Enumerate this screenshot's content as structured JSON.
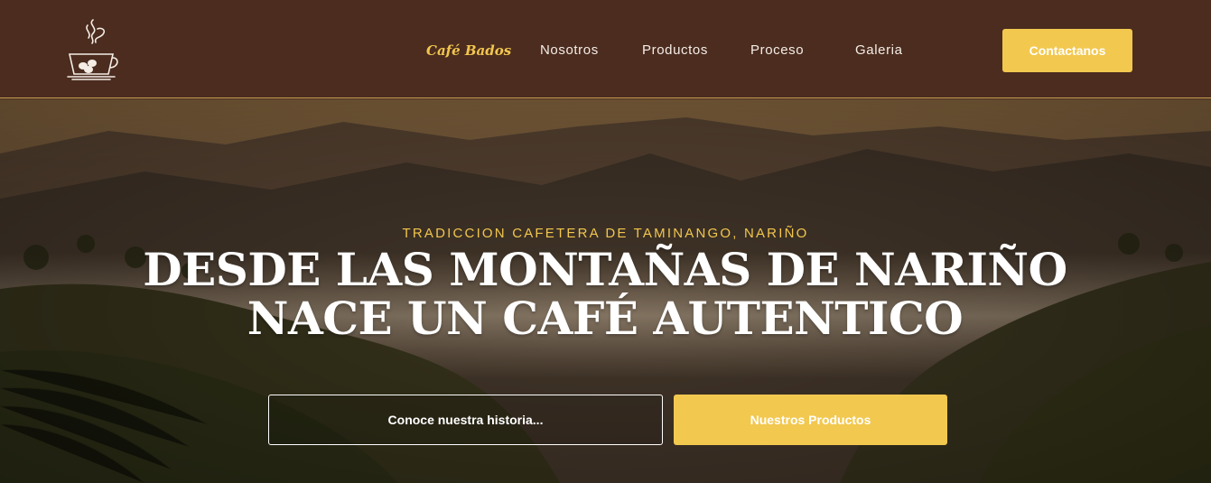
{
  "header": {
    "logo_icon": "coffee-cup-icon",
    "nav": {
      "brand": "Café Bados",
      "items": [
        "Nosotros",
        "Productos",
        "Proceso",
        "Galeria"
      ]
    },
    "cta_label": "Contactanos"
  },
  "hero": {
    "eyebrow": "TRADICCION CAFETERA DE TAMINANGO, NARIÑO",
    "headline_line1": "DESDE LAS MONTAÑAS DE NARIÑO",
    "headline_line2": "NACE UN CAFÉ AUTENTICO",
    "primary_button": "Conoce nuestra historia...",
    "secondary_button": "Nuestros Productos"
  },
  "colors": {
    "header_bg": "#4b2c1f",
    "accent": "#f2c84f",
    "text_light": "#f4ede6"
  }
}
